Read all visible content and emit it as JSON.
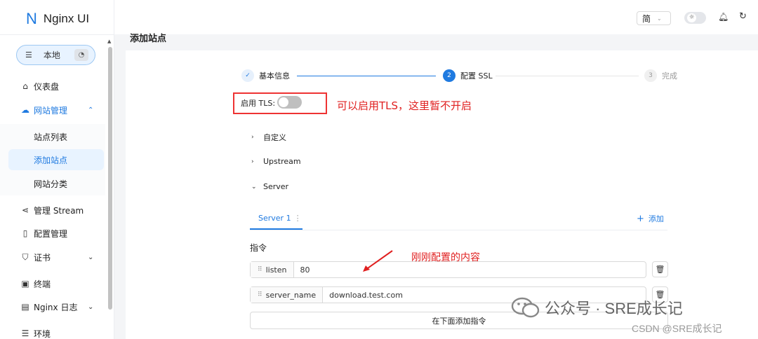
{
  "app": {
    "logo_mark": "N",
    "name": "Nginx UI"
  },
  "env": {
    "label": "本地",
    "icon": "server-icon",
    "status_icon": "gauge-icon"
  },
  "sidebar": {
    "items": [
      {
        "label": "仪表盘",
        "icon": "home-icon"
      },
      {
        "label": "网站管理",
        "icon": "cloud-icon",
        "expanded": true
      },
      {
        "label": "管理 Stream",
        "icon": "share-icon"
      },
      {
        "label": "配置管理",
        "icon": "file-icon"
      },
      {
        "label": "证书",
        "icon": "shield-icon"
      },
      {
        "label": "终端",
        "icon": "terminal-icon"
      },
      {
        "label": "Nginx 日志",
        "icon": "log-icon"
      },
      {
        "label": "环境",
        "icon": "list-icon"
      }
    ],
    "sub_items": [
      {
        "label": "站点列表"
      },
      {
        "label": "添加站点",
        "active": true
      },
      {
        "label": "网站分类"
      }
    ]
  },
  "header": {
    "language": "简",
    "icons": [
      "sun-icon",
      "bell-icon",
      "reload-icon"
    ]
  },
  "page": {
    "title": "添加站点"
  },
  "steps": [
    {
      "index": "✓",
      "label": "基本信息",
      "status": "done"
    },
    {
      "index": "2",
      "label": "配置 SSL",
      "status": "active"
    },
    {
      "index": "3",
      "label": "完成",
      "status": "wait"
    }
  ],
  "tls": {
    "label": "启用 TLS:",
    "enabled": false,
    "note": "可以启用TLS，这里暂不开启"
  },
  "collapse": [
    {
      "label": "自定义",
      "expanded": false
    },
    {
      "label": "Upstream",
      "expanded": false
    },
    {
      "label": "Server",
      "expanded": true
    }
  ],
  "server_tabs": {
    "active": "Server 1",
    "more": "⋮",
    "add_label": "添加",
    "add_icon": "+"
  },
  "directives": {
    "section_label": "指令",
    "rows": [
      {
        "name": "listen",
        "value": "80"
      },
      {
        "name": "server_name",
        "value": "download.test.com"
      }
    ],
    "add_label": "在下面添加指令"
  },
  "annotation": "刚刚配置的内容",
  "watermark": {
    "text": "公众号 · SRE成长记",
    "csdn": "CSDN @SRE成长记"
  },
  "colors": {
    "accent": "#1f7ae0",
    "annotation": "#e02020",
    "active_bg": "#e8f3ff"
  }
}
